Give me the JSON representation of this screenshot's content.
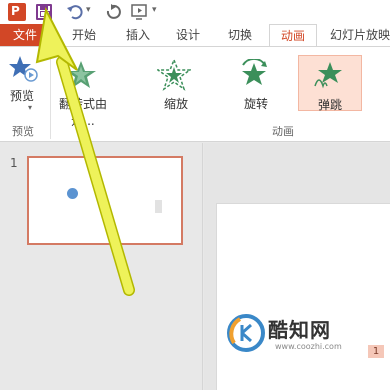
{
  "quick_access": {
    "app_icon": "P",
    "icons": [
      "save-icon",
      "undo-icon",
      "redo-icon",
      "from-beginning-icon"
    ]
  },
  "tabs": [
    {
      "label": "文件",
      "active": false
    },
    {
      "label": "开始",
      "active": false
    },
    {
      "label": "插入",
      "active": false
    },
    {
      "label": "设计",
      "active": false
    },
    {
      "label": "切换",
      "active": false
    },
    {
      "label": "动画",
      "active": true
    },
    {
      "label": "幻灯片放映",
      "active": false
    }
  ],
  "ribbon": {
    "preview_label": "预览",
    "preview_group_label": "预览",
    "animation_group_label": "动画",
    "animations": [
      {
        "label": "翻转式由远...",
        "selected": false
      },
      {
        "label": "缩放",
        "selected": false
      },
      {
        "label": "旋转",
        "selected": false
      },
      {
        "label": "弹跳",
        "selected": true
      }
    ]
  },
  "slides": {
    "number": "1",
    "animation_badge": "1"
  },
  "watermark": {
    "title": "酷知网",
    "url": "www.coozhi.com"
  },
  "colors": {
    "accent": "#d24726",
    "selected_bg": "#fde0d4",
    "star_green": "#3b8f5a",
    "arrow": "#eef25a"
  }
}
